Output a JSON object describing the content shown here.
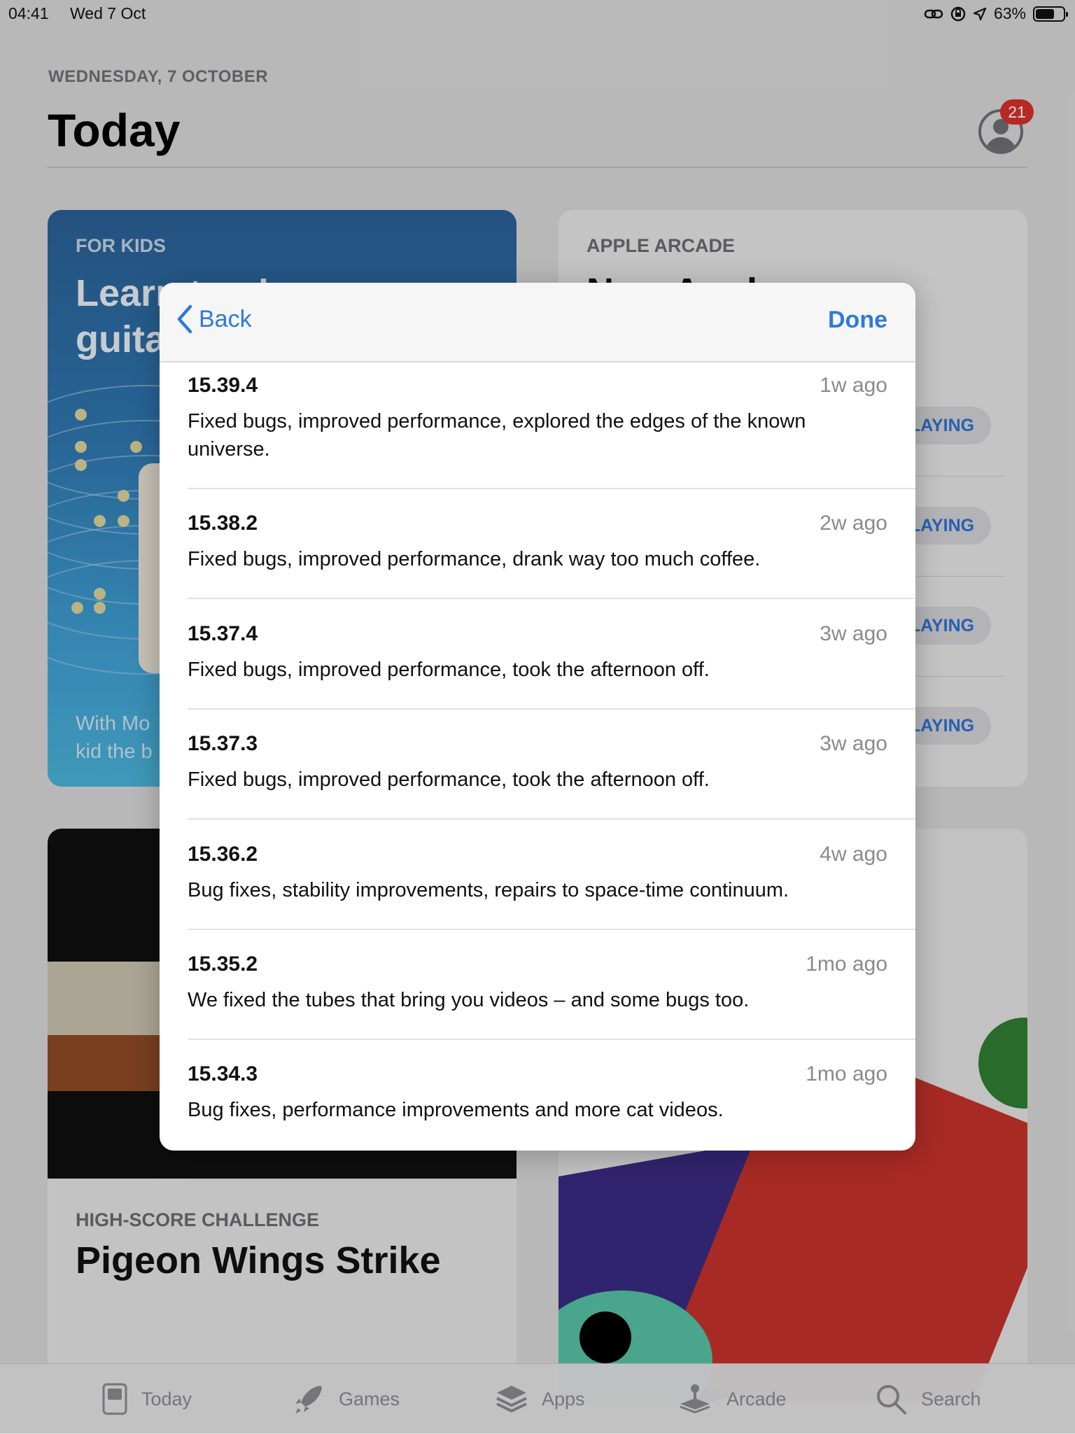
{
  "status_bar": {
    "time": "04:41",
    "date": "Wed 7 Oct",
    "battery": "63%",
    "battery_level": 0.63
  },
  "header": {
    "date": "WEDNESDAY, 7 OCTOBER",
    "title": "Today",
    "badge_count": "21"
  },
  "cards": {
    "kids": {
      "label": "FOR KIDS",
      "headline_1": "Learn to play",
      "headline_2": "guitar",
      "footer_1": "With Mo",
      "footer_2": "kid the b"
    },
    "arcade": {
      "label": "APPLE ARCADE",
      "headline": "New Apple",
      "buttons": [
        "LAYING",
        "LAYING",
        "LAYING",
        "LAYING"
      ]
    },
    "pigeon": {
      "label": "HIGH-SCORE CHALLENGE",
      "headline": "Pigeon Wings Strike"
    }
  },
  "modal": {
    "back_label": "Back",
    "done_label": "Done",
    "entries": [
      {
        "version": "15.39.4",
        "ago": "1w ago",
        "notes": "Fixed bugs, improved performance, explored the edges of the known universe."
      },
      {
        "version": "15.38.2",
        "ago": "2w ago",
        "notes": "Fixed bugs, improved performance, drank way too much coffee."
      },
      {
        "version": "15.37.4",
        "ago": "3w ago",
        "notes": "Fixed bugs, improved performance, took the afternoon off."
      },
      {
        "version": "15.37.3",
        "ago": "3w ago",
        "notes": "Fixed bugs, improved performance, took the afternoon off."
      },
      {
        "version": "15.36.2",
        "ago": "4w ago",
        "notes": "Bug fixes, stability improvements, repairs to space-time continuum."
      },
      {
        "version": "15.35.2",
        "ago": "1mo ago",
        "notes": "We fixed the tubes that bring you videos – and some bugs too."
      },
      {
        "version": "15.34.3",
        "ago": "1mo ago",
        "notes": "Bug fixes, performance improvements and more cat videos."
      }
    ]
  },
  "tab_bar": {
    "tabs": [
      {
        "label": "Today",
        "icon": "today-icon"
      },
      {
        "label": "Games",
        "icon": "rocket-icon"
      },
      {
        "label": "Apps",
        "icon": "stack-icon"
      },
      {
        "label": "Arcade",
        "icon": "joystick-icon"
      },
      {
        "label": "Search",
        "icon": "search-icon"
      }
    ]
  },
  "colors": {
    "accent": "#2f7ad8",
    "badge": "#d6302a",
    "kids_card": "#2f76ae"
  }
}
